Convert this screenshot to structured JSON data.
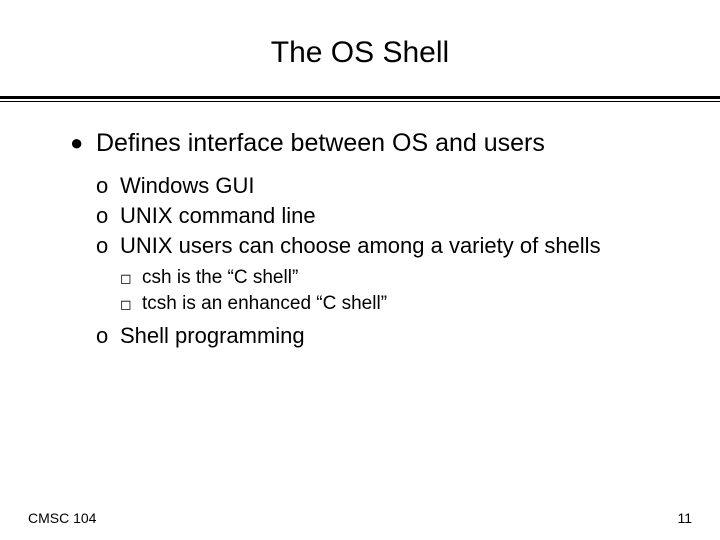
{
  "title": "The OS Shell",
  "bullets": {
    "main": "Defines interface between OS and users",
    "sub": {
      "0": "Windows GUI",
      "1": "UNIX command line",
      "2": "UNIX users can choose among a variety of shells",
      "3": "Shell programming"
    },
    "detail": {
      "0": "csh is the “C shell”",
      "1": "tcsh is an enhanced “C shell”"
    }
  },
  "footer": {
    "left": "CMSC 104",
    "right": "11"
  },
  "markers": {
    "disc": "●",
    "o": "o",
    "square": "◻"
  }
}
